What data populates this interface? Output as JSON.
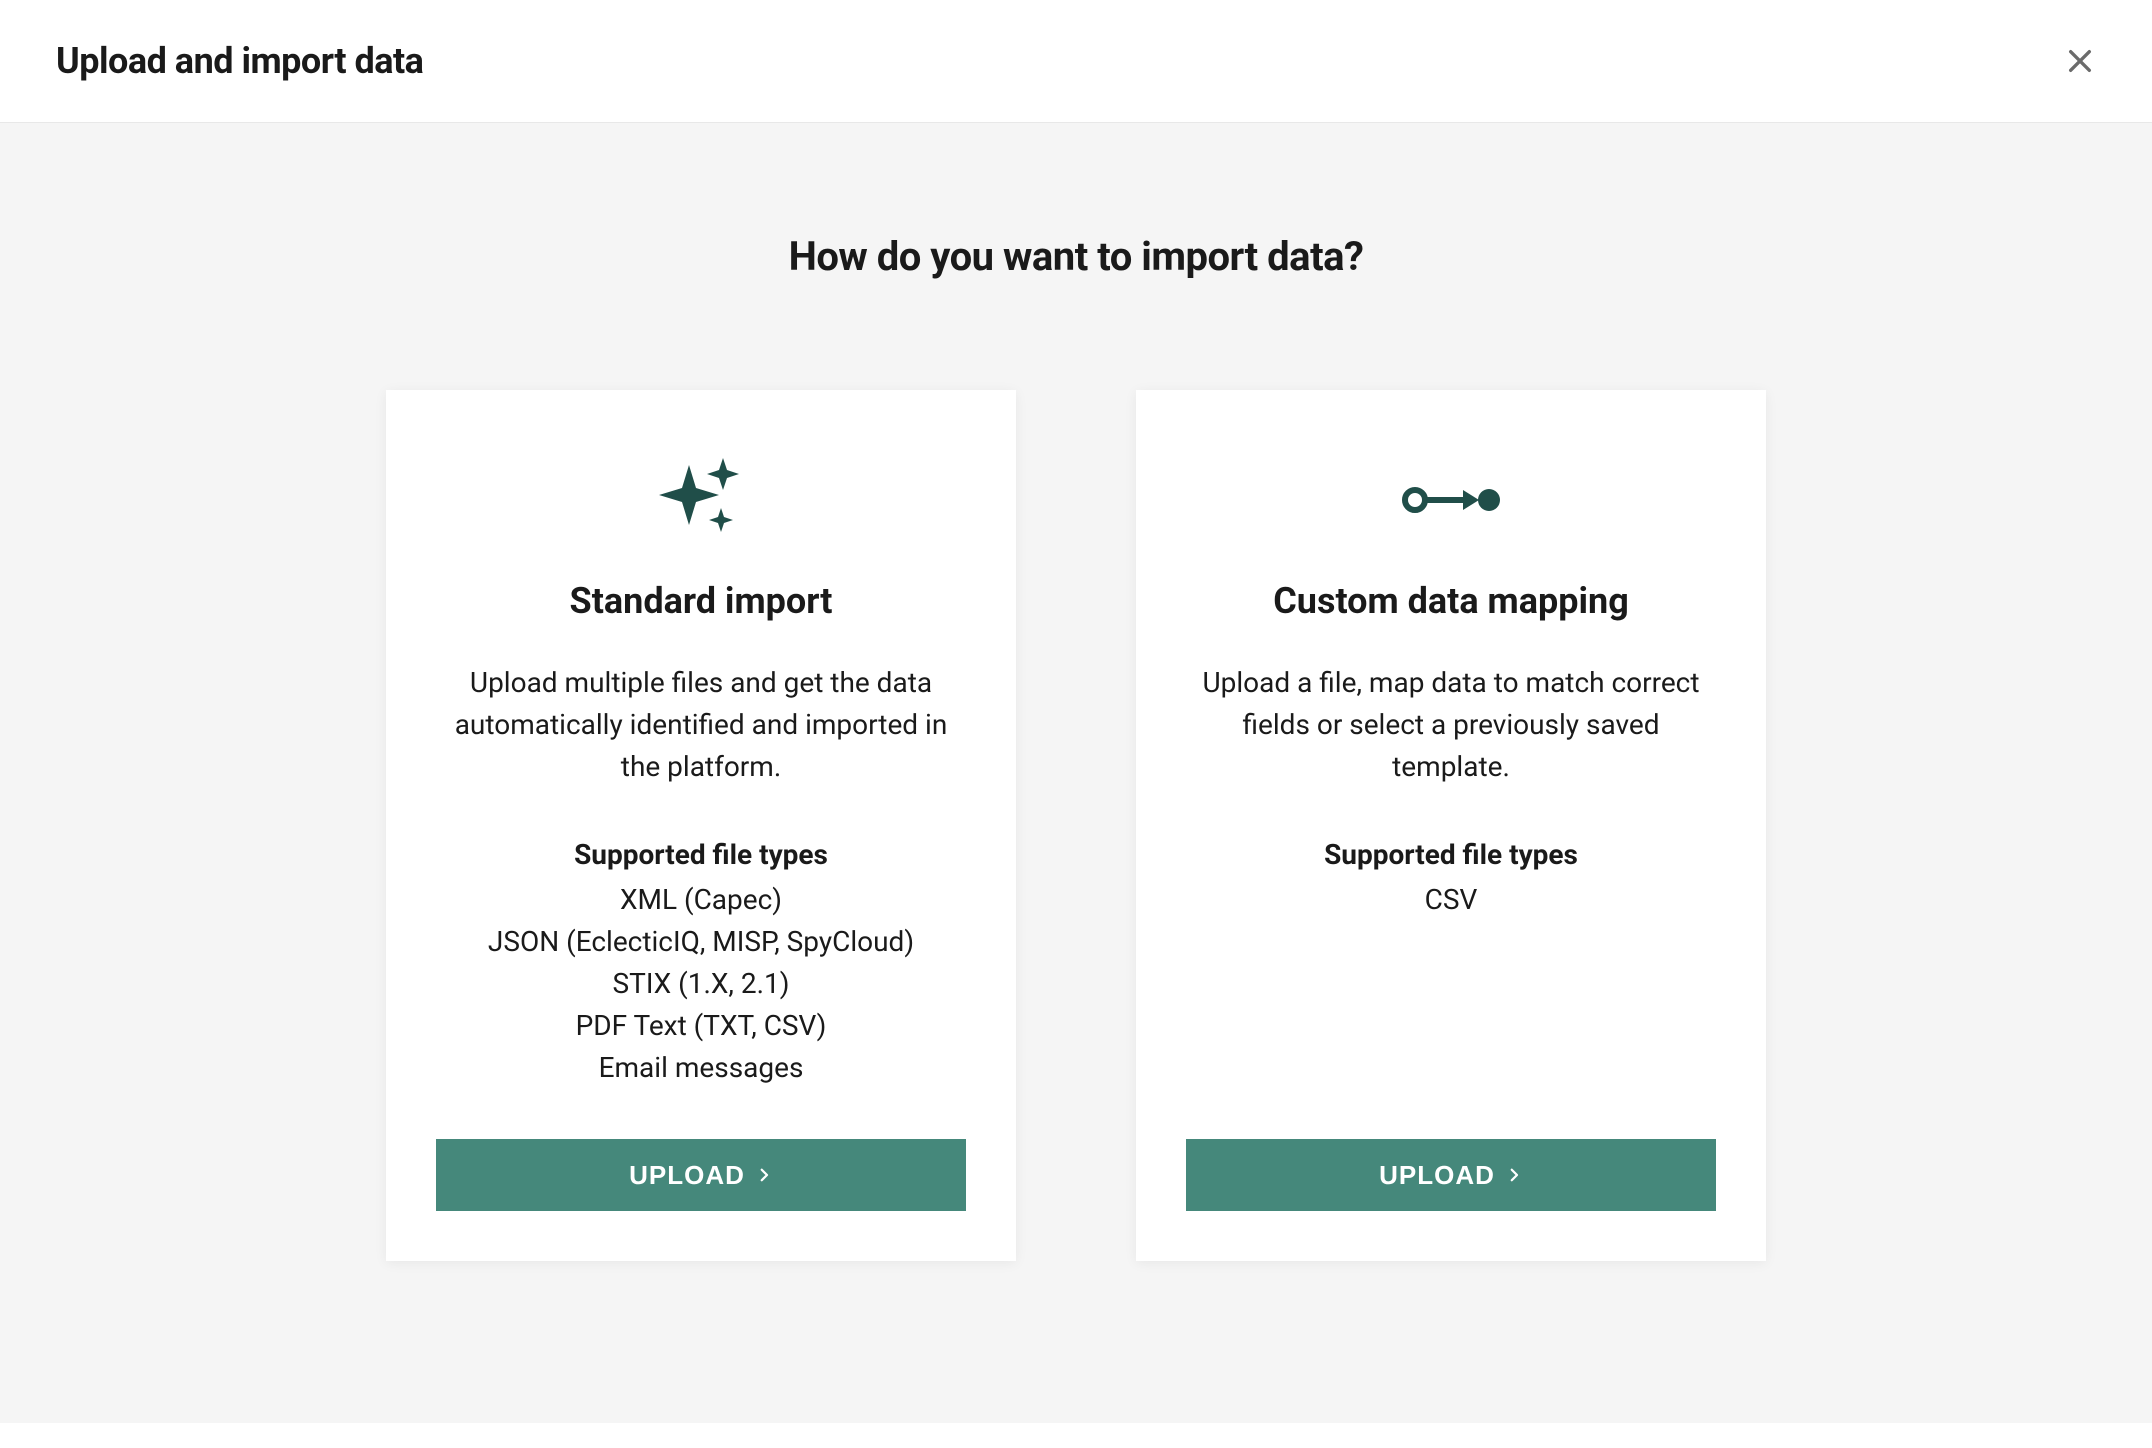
{
  "header": {
    "title": "Upload and import data"
  },
  "main": {
    "question": "How do you want to import data?",
    "cards": [
      {
        "title": "Standard import",
        "description": "Upload multiple files and get the data automatically identified and imported in the platform.",
        "supported_heading": "Supported file types",
        "file_types": [
          "XML (Capec)",
          "JSON (EclecticIQ, MISP, SpyCloud)",
          "STIX (1.X, 2.1)",
          "PDF Text (TXT, CSV)",
          "Email messages"
        ],
        "button_label": "UPLOAD"
      },
      {
        "title": "Custom data mapping",
        "description": "Upload a file, map data to match correct fields or select a previously saved template.",
        "supported_heading": "Supported file types",
        "file_types": [
          "CSV"
        ],
        "button_label": "UPLOAD"
      }
    ]
  }
}
